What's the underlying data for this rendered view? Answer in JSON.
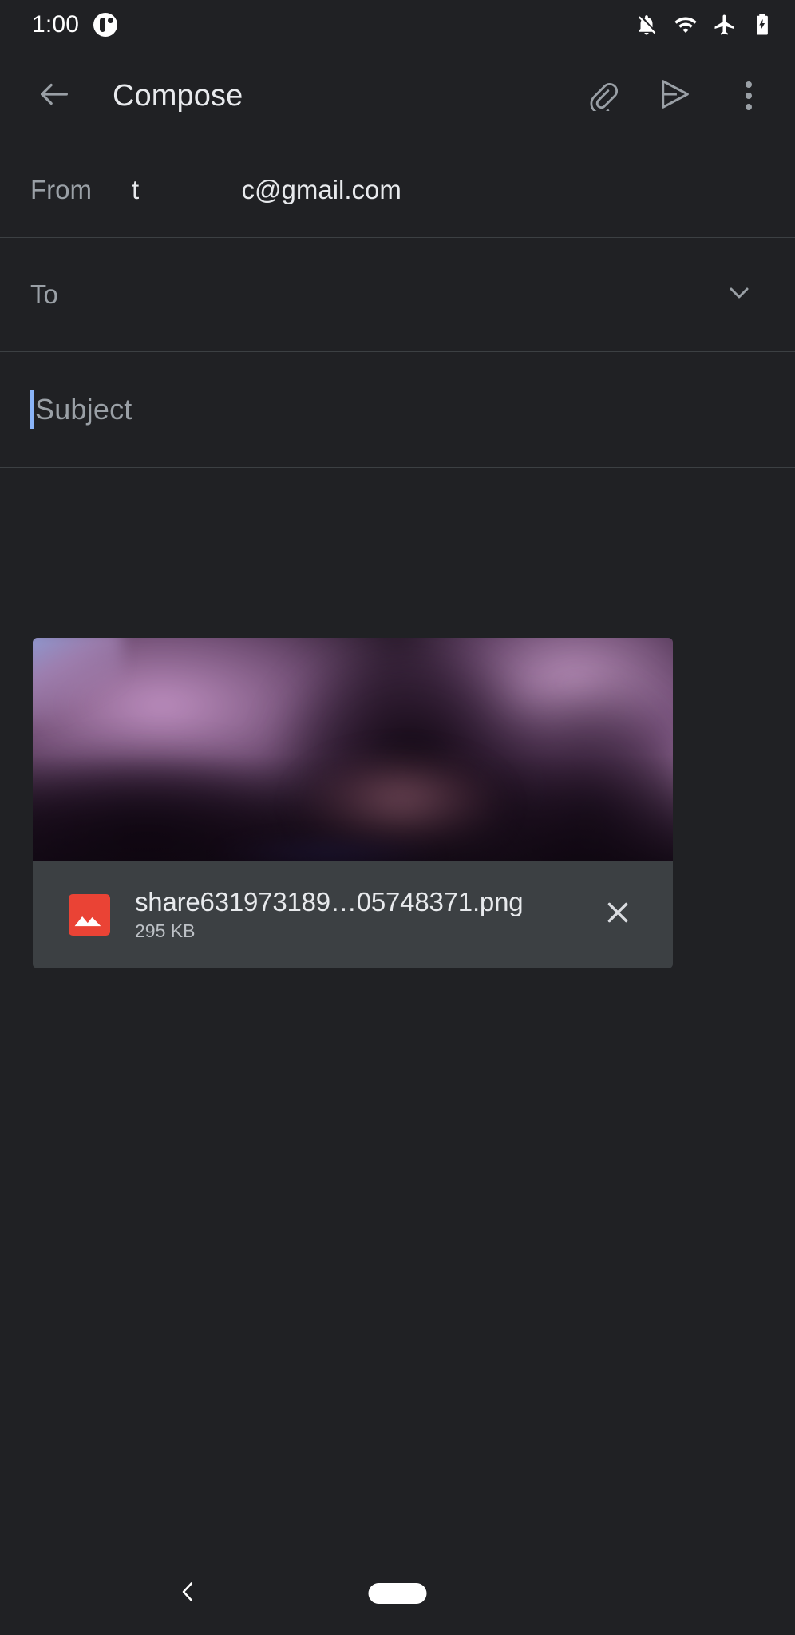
{
  "app": {
    "name": "Gmail Compose",
    "background_color": "#202124",
    "surface_color": "#3c4043",
    "divider_color": "#3c4043",
    "accent_color": "#8ab4f8",
    "primary_text_color": "#e8eaed",
    "secondary_text_color": "#9aa0a6"
  },
  "status_bar": {
    "clock": "1:00",
    "app_icon": "app-notification-icon",
    "icons": [
      {
        "name": "notifications-off-icon"
      },
      {
        "name": "wifi-icon"
      },
      {
        "name": "airplane-mode-icon"
      },
      {
        "name": "battery-charging-icon"
      }
    ]
  },
  "toolbar": {
    "back_icon": "back-arrow-icon",
    "title": "Compose",
    "attach_icon": "paperclip-icon",
    "send_icon": "send-icon",
    "overflow_icon": "more-vert-icon"
  },
  "fields": {
    "from": {
      "label": "From",
      "value": "t              c@gmail.com"
    },
    "to": {
      "label": "To",
      "value": "",
      "expand_icon": "chevron-down-icon"
    },
    "subject": {
      "placeholder": "Subject",
      "value": "",
      "focused": true
    },
    "body": {
      "placeholder": "",
      "value": ""
    }
  },
  "attachment": {
    "file_name": "share631973189…05748371.png",
    "file_size": "295 KB",
    "file_type_icon": "image-file-icon",
    "remove_icon": "close-icon",
    "preview_alt": "blurred purple photo"
  },
  "nav_bar": {
    "back_icon": "nav-back-chevron-icon",
    "home_icon": "nav-home-pill-icon"
  }
}
